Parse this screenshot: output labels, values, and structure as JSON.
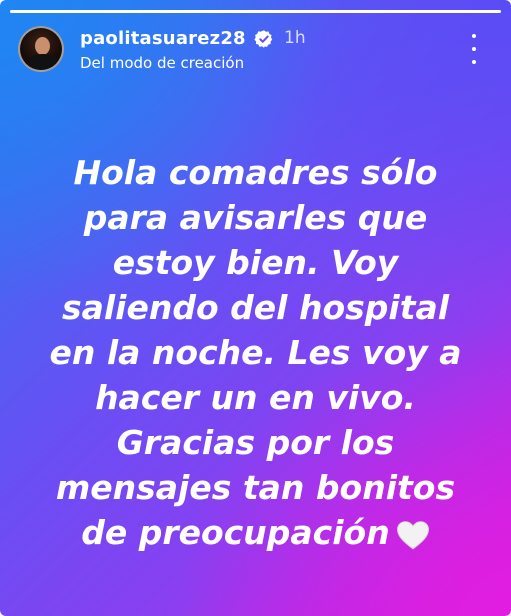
{
  "story": {
    "progress": 1.0,
    "header": {
      "username": "paolitasuarez28",
      "verified_icon": "verified-badge-icon",
      "time": "1h",
      "subtitle": "Del modo de creación",
      "menu_icon": "more-vertical-icon"
    },
    "message": {
      "lines": [
        "Hola comadres sólo",
        "para avisarles que",
        "estoy bien. Voy",
        "saliendo del hospital",
        "en la noche. Les voy a",
        "hacer un en vivo.",
        "Gracias por los",
        "mensajes tan bonitos",
        "de preocupación"
      ],
      "emoji_icon": "white-heart-icon"
    },
    "colors": {
      "gradient_start": "#1f86f2",
      "gradient_mid": "#6a4ef4",
      "gradient_end": "#e21de0",
      "text": "#ffffff"
    }
  }
}
